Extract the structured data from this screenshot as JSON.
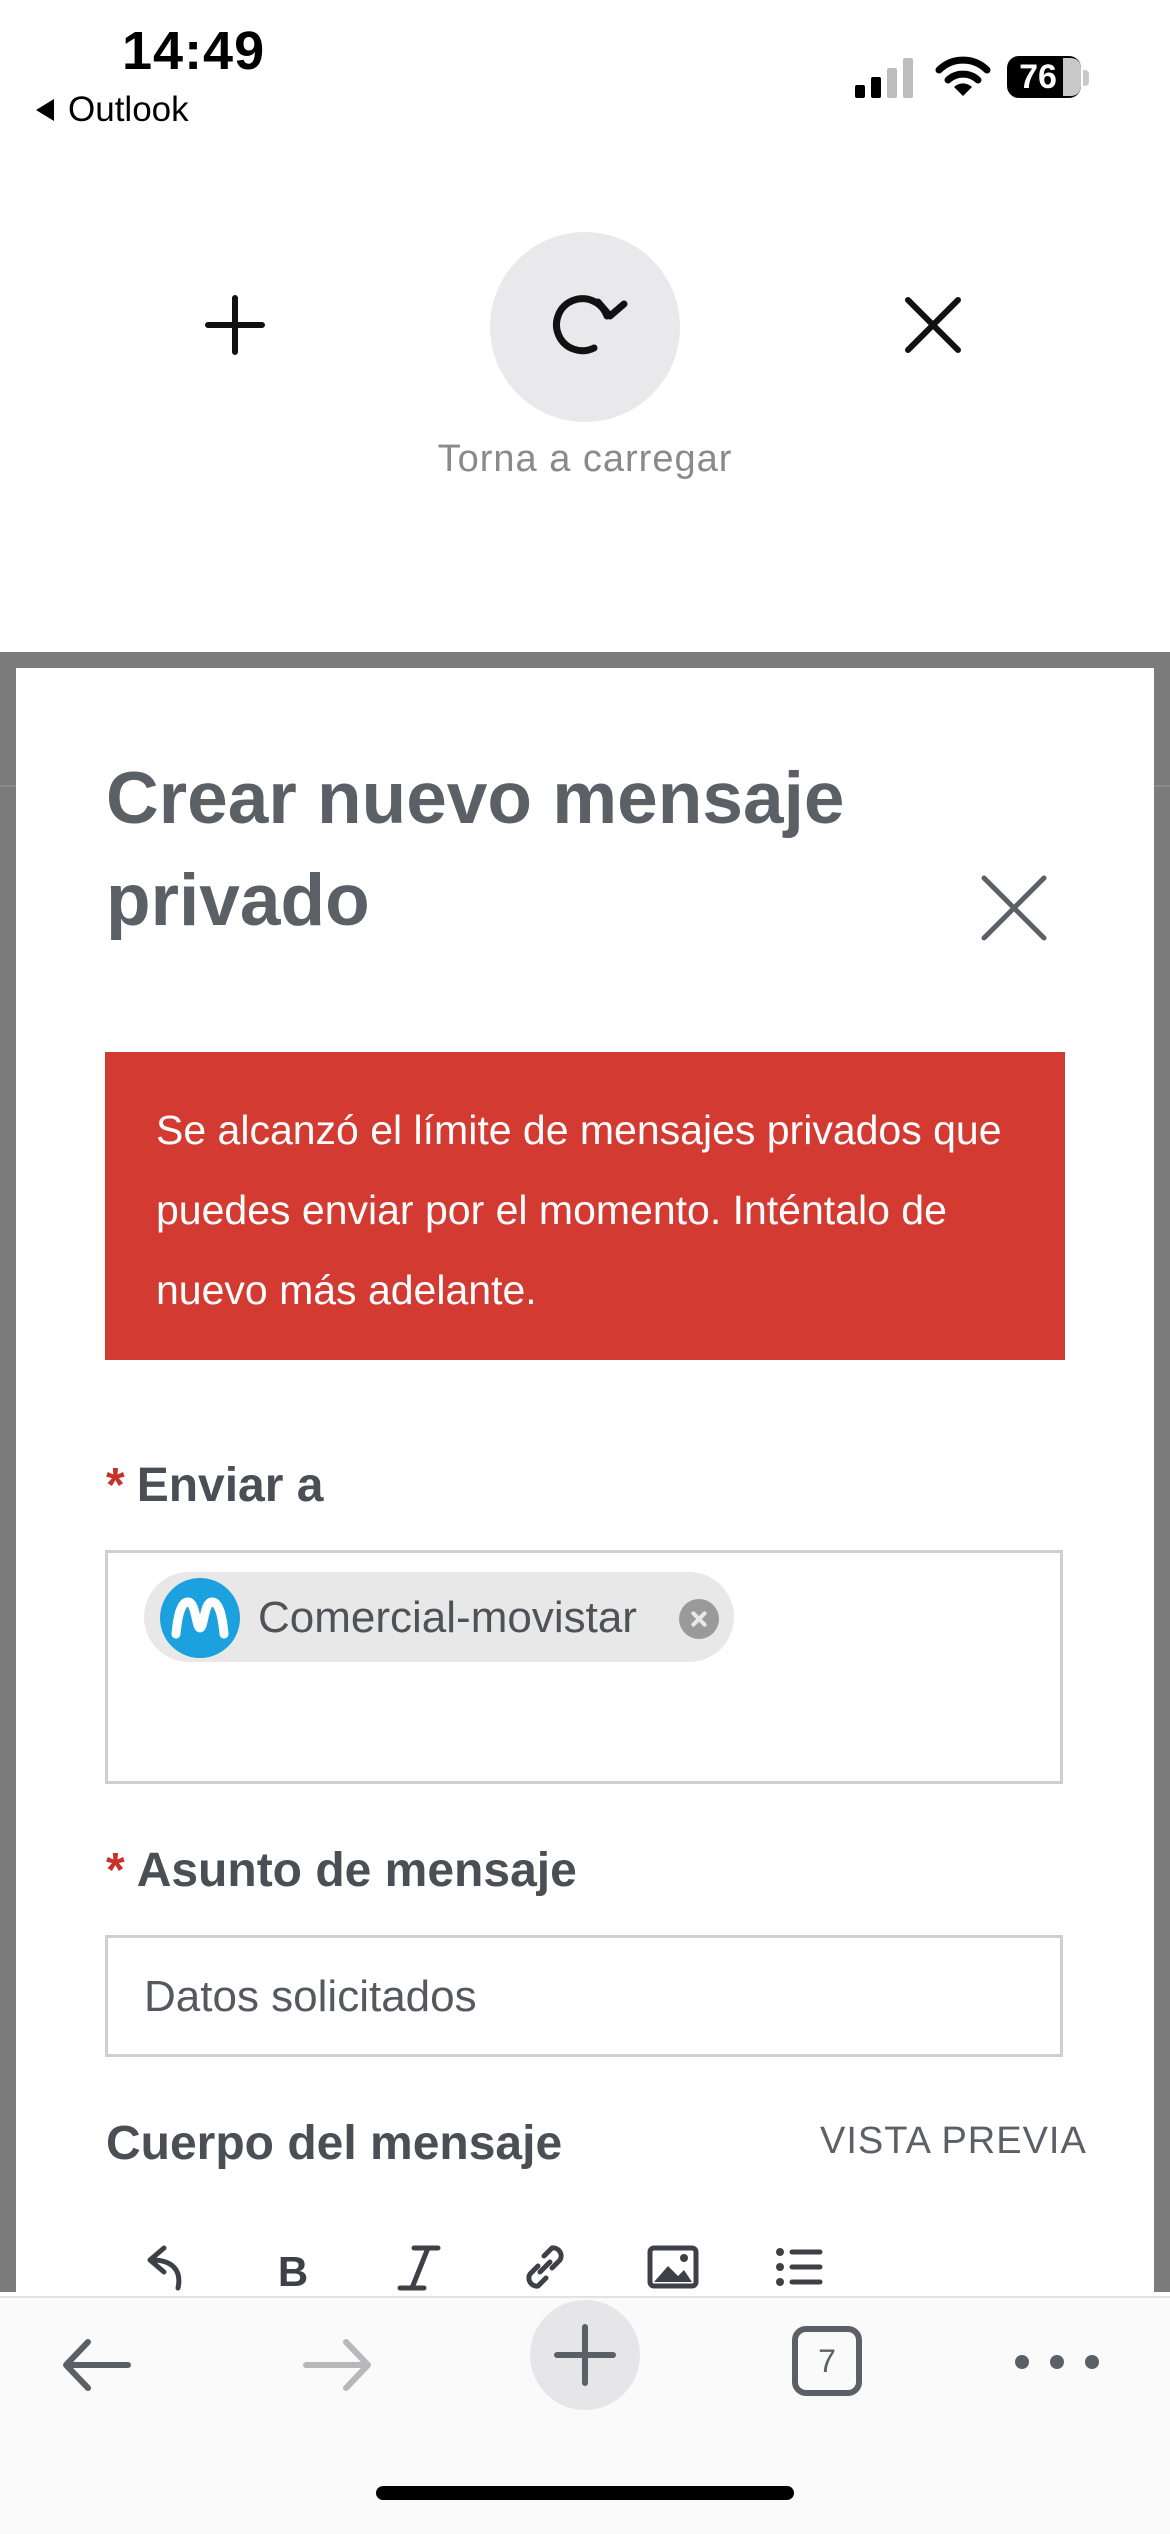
{
  "status_bar": {
    "time": "14:49",
    "back_app": "Outlook",
    "battery": "76"
  },
  "browser": {
    "reload_label": "Torna a carregar"
  },
  "modal": {
    "title": "Crear nuevo mensaje privado",
    "error": "Se alcanzó el límite de mensajes privados que puedes enviar por el momento. Inténtalo de nuevo más adelante.",
    "to": {
      "required_mark": "*",
      "label": "Enviar a",
      "recipient": "Comercial-movistar"
    },
    "subject": {
      "required_mark": "*",
      "label": "Asunto de mensaje",
      "value": "Datos solicitados"
    },
    "body": {
      "label": "Cuerpo del mensaje",
      "preview": "VISTA PREVIA"
    },
    "toolbar_icons": [
      "undo-icon",
      "bold-icon",
      "italic-icon",
      "link-icon",
      "image-icon",
      "list-icon"
    ]
  },
  "bottom_bar": {
    "tab_count": "7"
  },
  "colors": {
    "alert": "#d33a31",
    "brand_avatar": "#1aa1de",
    "required": "#c8302a"
  }
}
